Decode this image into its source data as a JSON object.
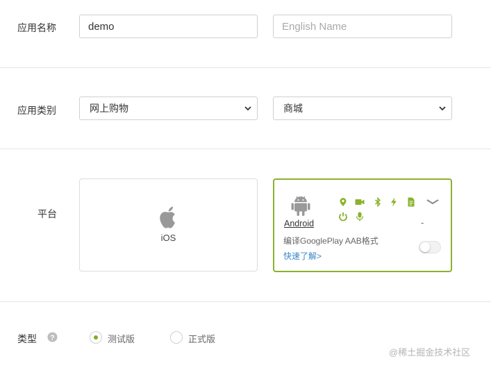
{
  "app_name": {
    "label": "应用名称",
    "name_value": "demo",
    "english_placeholder": "English Name"
  },
  "app_category": {
    "label": "应用类别",
    "primary_selected": "网上购物",
    "secondary_selected": "商城"
  },
  "platform": {
    "label": "平台",
    "ios": {
      "label": "iOS",
      "icon": "apple-icon"
    },
    "android": {
      "label": "Android",
      "icon": "android-robot-icon",
      "dash": "-",
      "permission_icons": [
        "location-icon",
        "camera-icon",
        "bluetooth-icon",
        "flash-icon",
        "file-icon",
        "power-icon",
        "microphone-icon"
      ],
      "aab_label": "编译GooglePlay AAB格式",
      "aab_enabled": false,
      "learn_more": "快速了解>"
    }
  },
  "type": {
    "label": "类型",
    "options": [
      {
        "label": "测试版",
        "selected": true
      },
      {
        "label": "正式版",
        "selected": false
      }
    ]
  },
  "watermark": "@稀土掘金技术社区",
  "colors": {
    "accent_green": "#8ab22c",
    "link_blue": "#3a86c8",
    "icon_gray": "#9a9a9a"
  }
}
